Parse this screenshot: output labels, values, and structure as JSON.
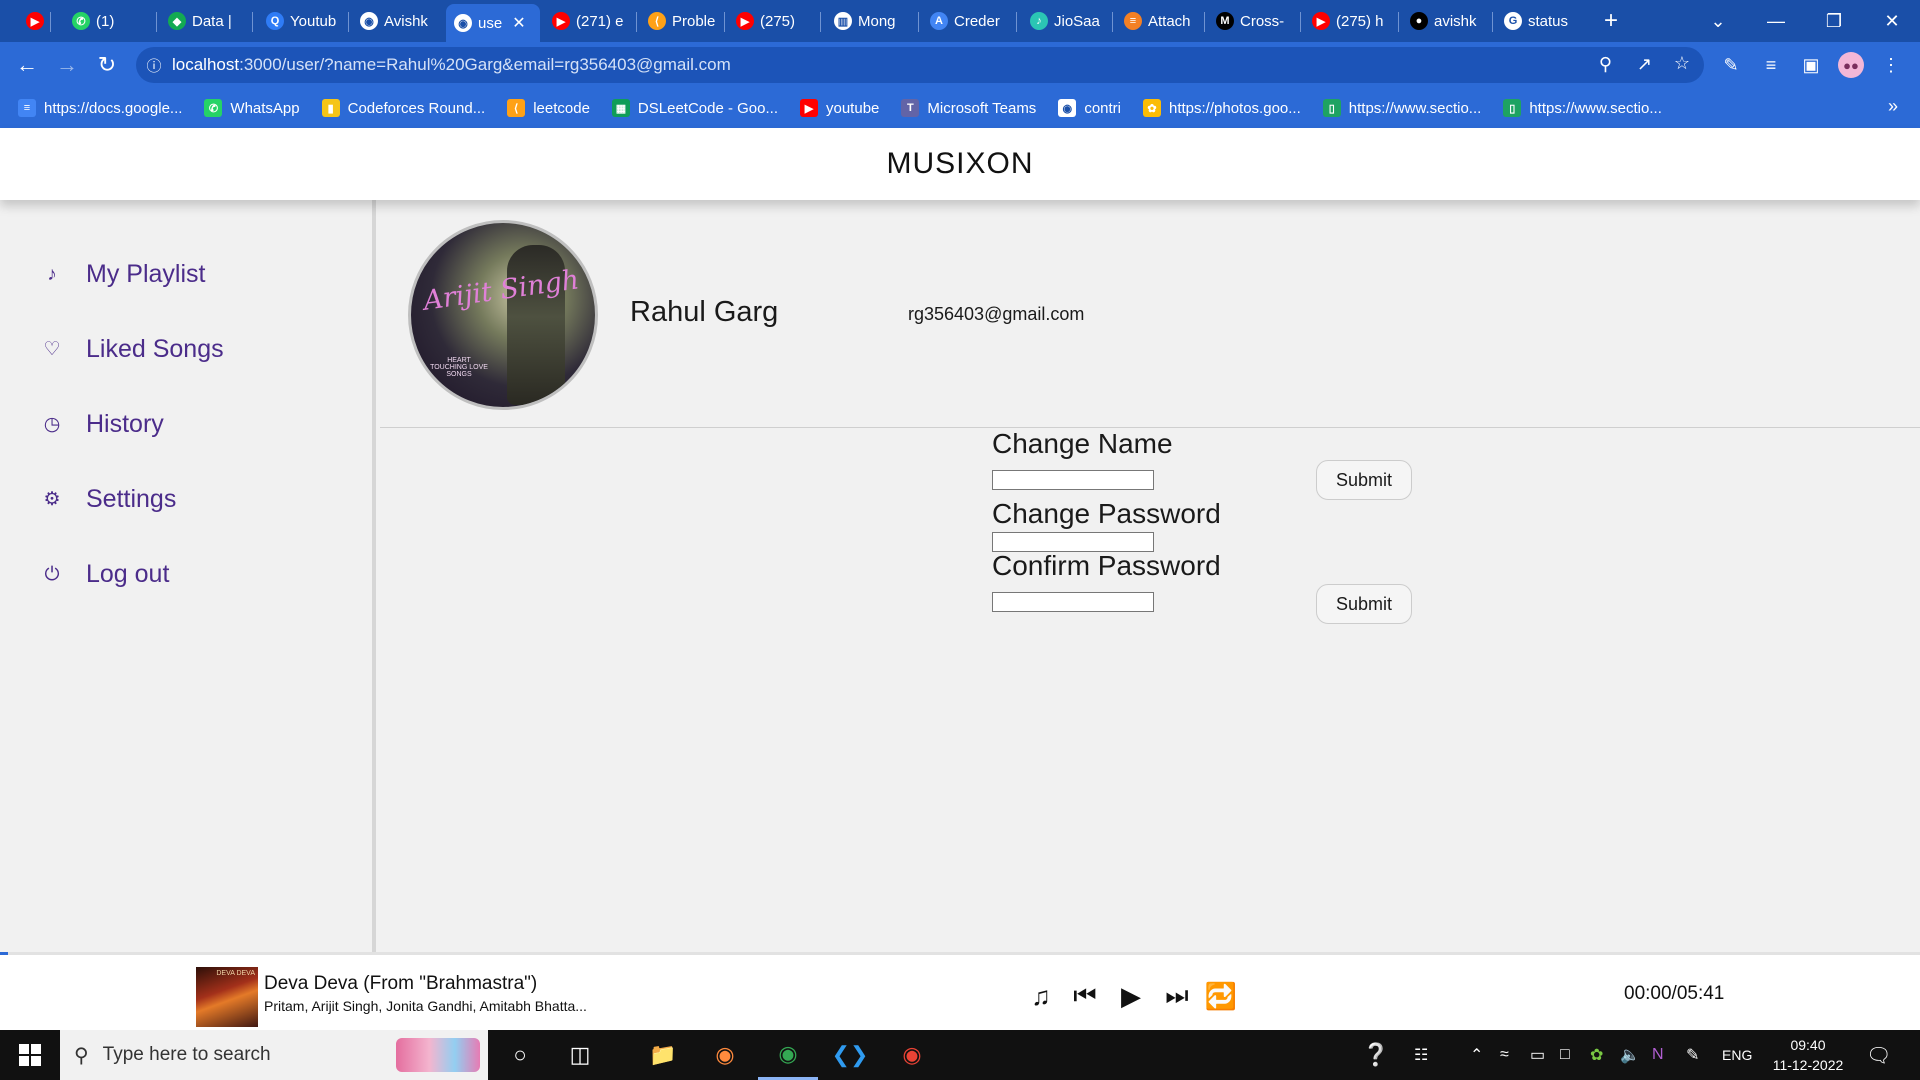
{
  "browser": {
    "tabs": [
      {
        "label": "",
        "icon": "youtube-icon",
        "color": "#ff0000"
      },
      {
        "label": "(1)",
        "icon": "whatsapp-icon",
        "color": "#25d366"
      },
      {
        "label": "Data |",
        "icon": "mongodb-icon",
        "color": "#13aa52"
      },
      {
        "label": "Youtub",
        "icon": "search-icon",
        "color": "#2f7cf6"
      },
      {
        "label": "Avishk",
        "icon": "globe-icon",
        "color": "#ffffff"
      },
      {
        "label": "use",
        "icon": "globe-icon",
        "color": "#ffffff",
        "active": true
      },
      {
        "label": "(271) e",
        "icon": "youtube-icon",
        "color": "#ff0000"
      },
      {
        "label": "Proble",
        "icon": "leetcode-icon",
        "color": "#ffa116"
      },
      {
        "label": "(275)",
        "icon": "youtube-icon",
        "color": "#ff0000"
      },
      {
        "label": "Mong",
        "icon": "mongo-book-icon",
        "color": "#ffffff"
      },
      {
        "label": "Creder",
        "icon": "api-icon",
        "color": "#4285f4"
      },
      {
        "label": "JioSaa",
        "icon": "jiosaavn-icon",
        "color": "#2bc5b4"
      },
      {
        "label": "Attach",
        "icon": "stackoverflow-icon",
        "color": "#f48024"
      },
      {
        "label": "Cross-",
        "icon": "medium-icon",
        "color": "#000000"
      },
      {
        "label": "(275) h",
        "icon": "youtube-icon",
        "color": "#ff0000"
      },
      {
        "label": "avishk",
        "icon": "github-icon",
        "color": "#000000"
      },
      {
        "label": "status",
        "icon": "google-icon",
        "color": "#ffffff"
      }
    ],
    "new_tab_label": "+",
    "url_host": "localhost",
    "url_path": ":3000/user/?name=Rahul%20Garg&email=rg356403@gmail.com",
    "bookmarks": [
      {
        "label": "https://docs.google...",
        "icon": "docs-icon",
        "color": "#4285f4"
      },
      {
        "label": "WhatsApp",
        "icon": "whatsapp-icon",
        "color": "#25d366"
      },
      {
        "label": "Codeforces Round...",
        "icon": "codeforces-icon",
        "color": "#f5c518"
      },
      {
        "label": "leetcode",
        "icon": "leetcode-icon",
        "color": "#ffa116"
      },
      {
        "label": "DSLeetCode - Goo...",
        "icon": "sheets-icon",
        "color": "#0f9d58"
      },
      {
        "label": "youtube",
        "icon": "youtube-icon",
        "color": "#ff0000"
      },
      {
        "label": "Microsoft Teams",
        "icon": "teams-icon",
        "color": "#6264a7"
      },
      {
        "label": "contri",
        "icon": "globe-icon",
        "color": "#ffffff"
      },
      {
        "label": "https://photos.goo...",
        "icon": "photos-icon",
        "color": "#fbbc05"
      },
      {
        "label": "https://www.sectio...",
        "icon": "section-icon",
        "color": "#1ea362"
      },
      {
        "label": "https://www.sectio...",
        "icon": "section-icon",
        "color": "#1ea362"
      }
    ],
    "bookmarks_more": "»"
  },
  "app": {
    "brand": "MUSIXON",
    "accent": "#4b2c8a",
    "sidebar": [
      {
        "label": "My Playlist",
        "icon": "music-note-icon",
        "glyph": "♪"
      },
      {
        "label": "Liked Songs",
        "icon": "heart-icon",
        "glyph": "♡"
      },
      {
        "label": "History",
        "icon": "clock-icon",
        "glyph": "◷"
      },
      {
        "label": "Settings",
        "icon": "gear-icon",
        "glyph": "⚙"
      },
      {
        "label": "Log out",
        "icon": "power-icon",
        "glyph": "⏻"
      }
    ],
    "profile": {
      "name": "Rahul Garg",
      "email": "rg356403@gmail.com",
      "avatar_text": "Arijit Singh",
      "avatar_subtext": "HEART TOUCHING LOVE SONGS"
    },
    "forms": {
      "change_name_label": "Change Name",
      "change_name_value": "",
      "change_password_label": "Change Password",
      "change_password_value": "",
      "confirm_password_label": "Confirm Password",
      "confirm_password_value": "",
      "submit_label": "Submit"
    },
    "player": {
      "title": "Deva Deva (From \"Brahmastra\")",
      "artists": "Pritam, Arijit Singh, Jonita Gandhi, Amitabh Bhatta...",
      "cover_text": "DEVA DEVA",
      "time": "00:00/05:41",
      "progress": 0
    }
  },
  "taskbar": {
    "search_placeholder": "Type here to search",
    "language": "ENG",
    "time": "09:40",
    "date": "11-12-2022"
  }
}
